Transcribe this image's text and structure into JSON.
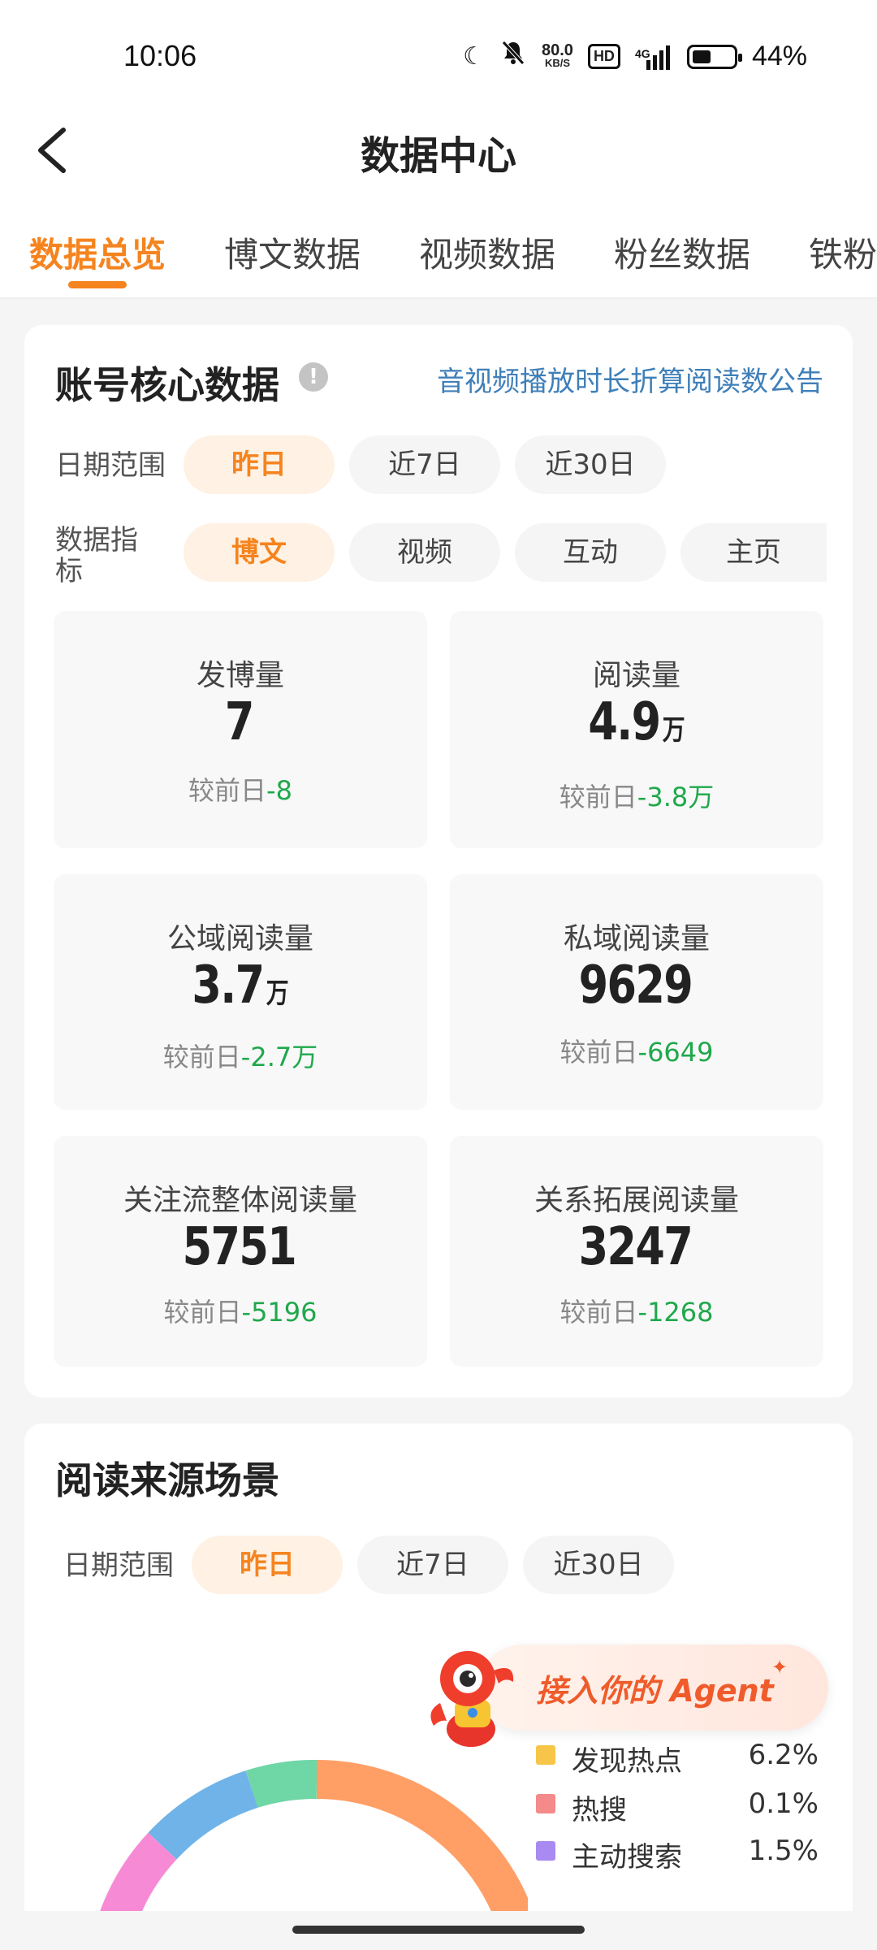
{
  "status_bar": {
    "time": "10:06",
    "net_speed_value": "80.0",
    "net_speed_unit": "KB/S",
    "hd_label": "HD",
    "signal_label": "4G",
    "battery_percent": "44%",
    "battery_level": 0.44
  },
  "header": {
    "title": "数据中心"
  },
  "tabs": [
    {
      "label": "数据总览",
      "active": true
    },
    {
      "label": "博文数据"
    },
    {
      "label": "视频数据"
    },
    {
      "label": "粉丝数据"
    },
    {
      "label": "铁粉"
    }
  ],
  "core": {
    "title": "账号核心数据",
    "info_icon": "!",
    "notice_link": "音视频播放时长折算阅读数公告",
    "date_label": "日期范围",
    "date_options": [
      {
        "label": "昨日",
        "active": true
      },
      {
        "label": "近7日"
      },
      {
        "label": "近30日"
      }
    ],
    "metric_label": "数据指标",
    "metric_label_line1": "数据指",
    "metric_label_line2": "标",
    "metric_options": [
      {
        "label": "博文",
        "active": true
      },
      {
        "label": "视频"
      },
      {
        "label": "互动"
      },
      {
        "label": "主页"
      }
    ],
    "stats": [
      {
        "label": "发博量",
        "value": "7",
        "unit": "",
        "compare_prefix": "较前日",
        "delta": "-8"
      },
      {
        "label": "阅读量",
        "value": "4.9",
        "unit": "万",
        "compare_prefix": "较前日",
        "delta": "-3.8万"
      },
      {
        "label": "公域阅读量",
        "value": "3.7",
        "unit": "万",
        "compare_prefix": "较前日",
        "delta": "-2.7万"
      },
      {
        "label": "私域阅读量",
        "value": "9629",
        "unit": "",
        "compare_prefix": "较前日",
        "delta": "-6649"
      },
      {
        "label": "关注流整体阅读量",
        "value": "5751",
        "unit": "",
        "compare_prefix": "较前日",
        "delta": "-5196"
      },
      {
        "label": "关系拓展阅读量",
        "value": "3247",
        "unit": "",
        "compare_prefix": "较前日",
        "delta": "-1268"
      }
    ]
  },
  "source": {
    "title": "阅读来源场景",
    "date_label": "日期范围",
    "date_options": [
      {
        "label": "昨日",
        "active": true
      },
      {
        "label": "近7日"
      },
      {
        "label": "近30日"
      }
    ],
    "legend": [
      {
        "name": "发现热点",
        "value": "6.2%",
        "color": "#f7c548"
      },
      {
        "name": "热搜",
        "value": "0.1%",
        "color": "#f58a8a"
      },
      {
        "name": "主动搜索",
        "value": "1.5%",
        "color": "#a98af0"
      }
    ],
    "donut_colors": [
      "#ff9f66",
      "#6fd6a6",
      "#6fb3e8",
      "#f78ad4"
    ]
  },
  "agent_banner": {
    "text": "接入你的 Agent",
    "star": "✦"
  }
}
